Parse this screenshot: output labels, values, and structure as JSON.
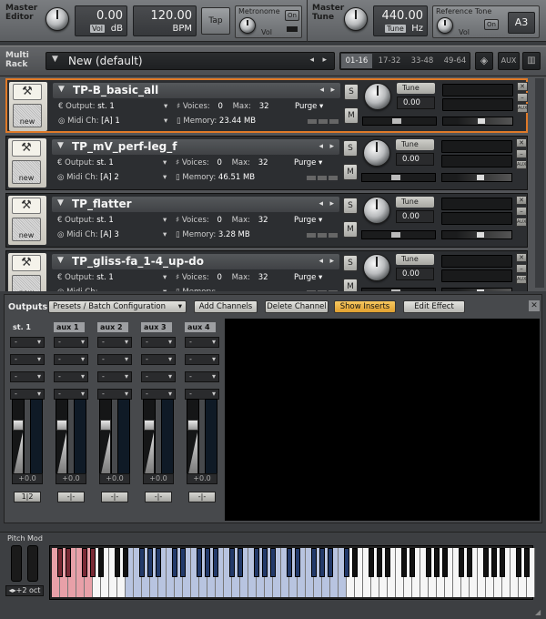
{
  "master_editor": {
    "label_line1": "Master",
    "label_line2": "Editor",
    "vol_value": "0.00",
    "vol_tag": "Vol",
    "vol_unit": "dB",
    "bpm_value": "120.00",
    "bpm_unit": "BPM",
    "tap_label": "Tap",
    "metronome_label": "Metronome",
    "metronome_on": "On",
    "metronome_vol": "Vol"
  },
  "master_tune": {
    "label_line1": "Master",
    "label_line2": "Tune",
    "tune_value": "440.00",
    "tune_tag": "Tune",
    "tune_unit": "Hz",
    "ref_tone_label": "Reference Tone",
    "ref_on": "On",
    "ref_vol": "Vol",
    "ref_note": "A3"
  },
  "rack": {
    "label_line1": "Multi",
    "label_line2": "Rack",
    "name": "New (default)",
    "pages": [
      "01-16",
      "17-32",
      "33-48",
      "49-64"
    ],
    "aux_label": "AUX"
  },
  "instruments": [
    {
      "name": "TP-B_basic_all",
      "output": "st. 1",
      "midi": "[A] 1",
      "voices": "0",
      "max": "32",
      "memory": "23.44 MB",
      "purge": "Purge",
      "tune": "0.00"
    },
    {
      "name": "TP_mV_perf-leg_f",
      "output": "st. 1",
      "midi": "[A] 2",
      "voices": "0",
      "max": "32",
      "memory": "46.51 MB",
      "purge": "Purge",
      "tune": "0.00"
    },
    {
      "name": "TP_flatter",
      "output": "st. 1",
      "midi": "[A] 3",
      "voices": "0",
      "max": "32",
      "memory": "3.28 MB",
      "purge": "Purge",
      "tune": "0.00"
    },
    {
      "name": "TP_gliss-fa_1-4_up-do",
      "output": "st. 1",
      "midi": "",
      "voices": "0",
      "max": "32",
      "memory": "",
      "purge": "Purge",
      "tune": "0.00"
    }
  ],
  "inst_labels": {
    "output": "Output:",
    "midi": "Midi Ch:",
    "voices": "Voices:",
    "max": "Max:",
    "memory": "Memory:",
    "tune": "Tune",
    "new": "new",
    "solo": "S",
    "mute": "M",
    "aux": "AUX"
  },
  "outputs": {
    "label": "Outputs",
    "preset": "Presets / Batch Configuration",
    "add": "Add Channels",
    "delete": "Delete Channel",
    "show_inserts": "Show Inserts",
    "edit_effect": "Edit Effect",
    "channels": [
      {
        "name": "st. 1",
        "value": "+0.0",
        "button": "1|2"
      },
      {
        "name": "aux 1",
        "value": "+0.0",
        "button": "-|-"
      },
      {
        "name": "aux 2",
        "value": "+0.0",
        "button": "-|-"
      },
      {
        "name": "aux 3",
        "value": "+0.0",
        "button": "-|-"
      },
      {
        "name": "aux 4",
        "value": "+0.0",
        "button": "-|-"
      }
    ],
    "insert_dash": "-"
  },
  "keyboard": {
    "pitch_mod": "Pitch Mod",
    "octave": "+2 oct"
  },
  "colors": {
    "selected_border": "#e07a28",
    "keyswitch_red": "#e8a0a8",
    "range_blue": "#b8c4e0",
    "show_inserts_active": "#f2b541"
  }
}
